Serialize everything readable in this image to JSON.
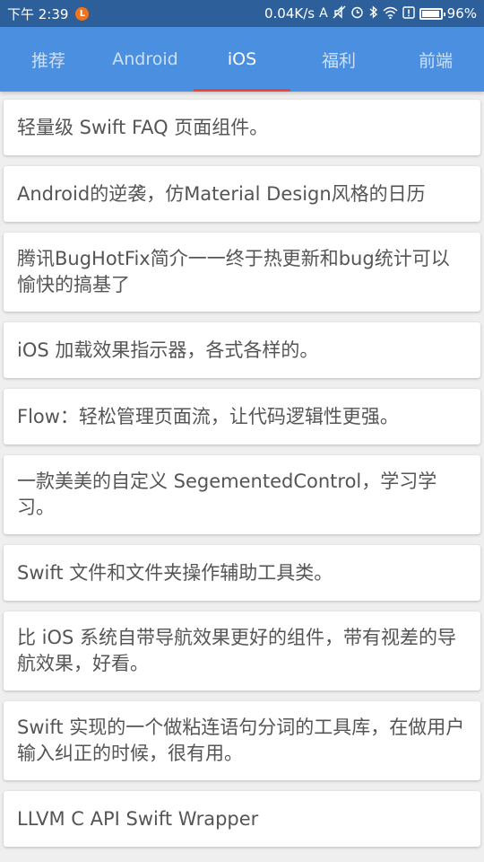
{
  "status_bar": {
    "time": "下午 2:39",
    "notification_badge": "L",
    "network_speed": "0.04K/s",
    "battery": "96%",
    "battery_level": 0.96,
    "icons": [
      "font-a-icon",
      "mute-icon",
      "alarm-icon",
      "bluetooth-icon",
      "wifi-icon",
      "alert-icon",
      "battery-icon"
    ]
  },
  "tabs": [
    {
      "label": "推荐",
      "active": false
    },
    {
      "label": "Android",
      "active": false
    },
    {
      "label": "iOS",
      "active": true
    },
    {
      "label": "福利",
      "active": false
    },
    {
      "label": "前端",
      "active": false
    }
  ],
  "items": [
    "轻量级 Swift FAQ 页面组件。",
    "Android的逆袭，仿Material Design风格的日历",
    "腾讯BugHotFix简介一一终于热更新和bug统计可以愉快的搞基了",
    "iOS 加载效果指示器，各式各样的。",
    "Flow：轻松管理页面流，让代码逻辑性更强。",
    "一款美美的自定义 SegementedControl，学习学习。",
    "Swift 文件和文件夹操作辅助工具类。",
    "比 iOS 系统自带导航效果更好的组件，带有视差的导航效果，好看。",
    "Swift 实现的一个做粘连语句分词的工具库，在做用户输入纠正的时候，很有用。",
    "LLVM C API Swift Wrapper"
  ],
  "colors": {
    "status_bar": "#2d5f9a",
    "tab_bar": "#4a8fe0",
    "indicator": "#e8453c",
    "background": "#efefef"
  }
}
